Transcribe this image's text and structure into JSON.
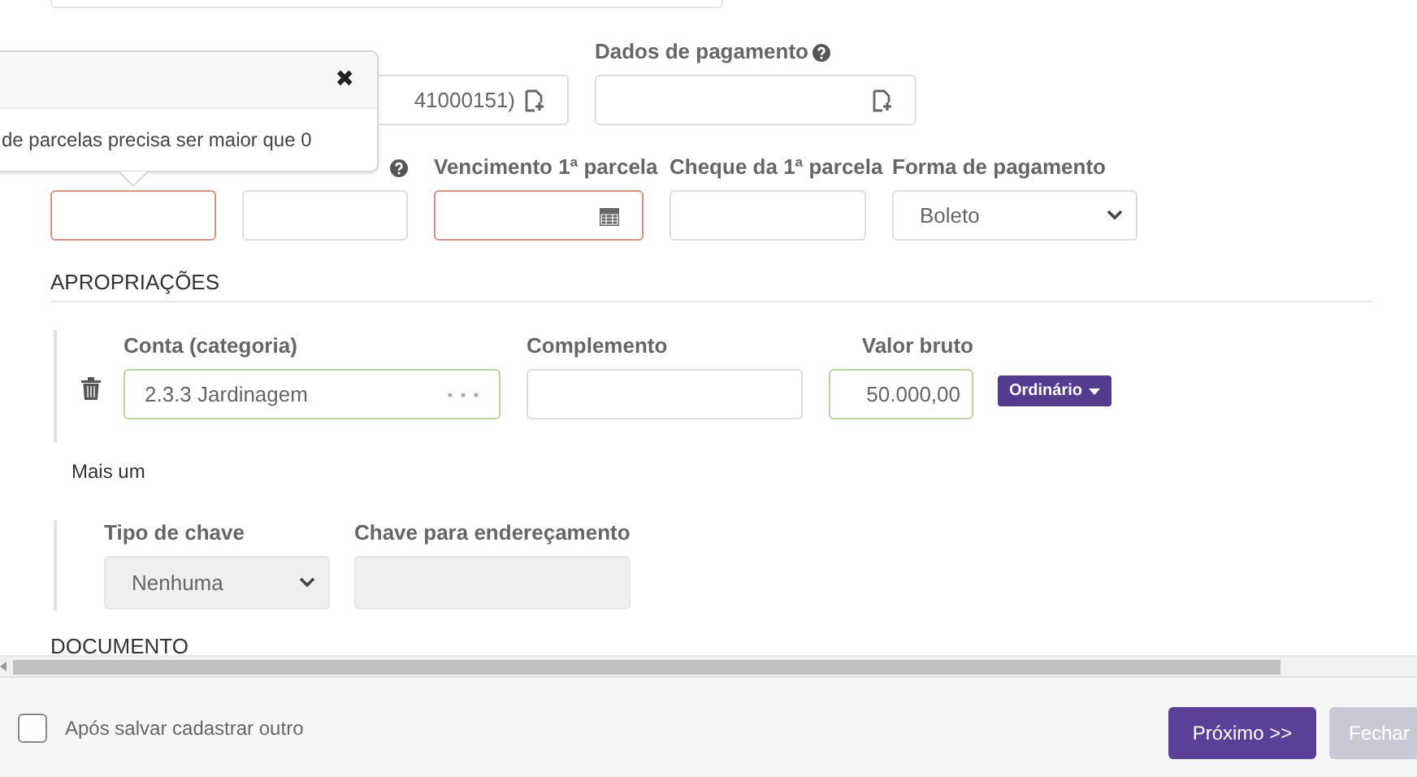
{
  "payment_row": {
    "fields": [
      {
        "kind": "lookup",
        "value": "41000151)"
      },
      {
        "label": "Dados de pagamento",
        "help": true,
        "kind": "lookup"
      }
    ]
  },
  "installment_row": {
    "fields": [
      {
        "kind": "text",
        "invalid": true
      },
      {
        "kind": "text",
        "help": true,
        "invalid": false
      },
      {
        "label": "Vencimento 1ª parcela",
        "kind": "date",
        "invalid": true
      },
      {
        "label": "Cheque da 1ª parcela",
        "kind": "text",
        "invalid": false
      },
      {
        "label": "Forma de pagamento",
        "kind": "select",
        "value": "Boleto",
        "invalid": false
      }
    ]
  },
  "popover": {
    "close": "✖",
    "message": "de parcelas precisa ser maior que 0"
  },
  "appropriations": {
    "title": "APROPRIAÇÕES",
    "columns": [
      "Conta (categoria)",
      "Complemento",
      "Valor bruto"
    ],
    "rows": [
      {
        "account": "2.3.3 Jardinagem",
        "amount": "50.000,00",
        "type": "Ordinário",
        "valid": true
      }
    ]
  },
  "add_more": "Mais um",
  "key_fields": {
    "fields": [
      {
        "label": "Tipo de chave",
        "kind": "select",
        "value": "Nenhuma",
        "disabled": true
      },
      {
        "label": "Chave para endereçamento",
        "kind": "text",
        "disabled": true
      }
    ]
  },
  "document_title": "DOCUMENTO",
  "footer": {
    "checkbox": {
      "label": "Após salvar cadastrar outro",
      "checked": false
    },
    "buttons": [
      {
        "label": "Próximo >>",
        "disabled": false
      },
      {
        "label": "Fechar",
        "disabled": true
      }
    ]
  }
}
